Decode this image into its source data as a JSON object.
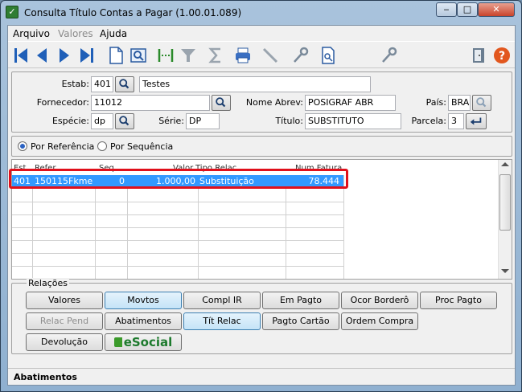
{
  "window": {
    "title": "Consulta Título Contas a Pagar (1.00.01.089)",
    "controls": {
      "minimize": "‒",
      "maximize": "□",
      "close": "✕"
    }
  },
  "menu": [
    "Arquivo",
    "Valores",
    "Ajuda"
  ],
  "toolbar_icons": [
    "first-record-icon",
    "previous-record-icon",
    "next-record-icon",
    "last-record-icon",
    "new-document-icon",
    "zoom-document-icon",
    "goto-icon",
    "filter-icon",
    "sum-icon",
    "print-icon",
    "pen-icon",
    "key-icon",
    "search-document-icon",
    "key-icon",
    "exit-door-icon",
    "help-icon"
  ],
  "header": {
    "estab_label": "Estab:",
    "estab_value": "401",
    "estab_name": "Testes",
    "fornecedor_label": "Fornecedor:",
    "fornecedor_value": "11012",
    "nome_abrev_label": "Nome Abrev:",
    "nome_abrev_value": "POSIGRAF ABR",
    "pais_label": "País:",
    "pais_value": "BRA",
    "especie_label": "Espécie:",
    "especie_value": "dp",
    "serie_label": "Série:",
    "serie_value": "DP",
    "titulo_label": "Título:",
    "titulo_value": "SUBSTITUTO",
    "parcela_label": "Parcela:",
    "parcela_value": "3"
  },
  "radios": {
    "por_referencia": "Por Referência",
    "por_sequencia": "Por Sequência",
    "selected": "por_referencia"
  },
  "grid": {
    "columns": [
      "Est",
      "Refer",
      "Seq",
      "Valor",
      "Tipo Relac",
      "Num Fatura"
    ],
    "rows": [
      {
        "est": "401",
        "refer": "150115Fkme",
        "seq": "0",
        "valor": "1.000,00",
        "tipo_relac": "Substituição",
        "num_fatura": "78.444"
      }
    ]
  },
  "relacoes": {
    "label": "Relações",
    "buttons": {
      "valores": "Valores",
      "movtos": "Movtos",
      "compl_ir": "Compl IR",
      "em_pagto": "Em Pagto",
      "ocor_bordero": "Ocor Borderô",
      "proc_pagto": "Proc Pagto",
      "relac_pend": "Relac Pend",
      "abatimentos": "Abatimentos",
      "tit_relac": "Tít Relac",
      "pagto_cartao": "Pagto Cartão",
      "ordem_compra": "Ordem Compra",
      "devolucao": "Devolução",
      "esocial": "eSocial"
    }
  },
  "status": {
    "text": "Abatimentos"
  },
  "colors": {
    "selection": "#3399ff",
    "highlight_border": "#e0101b",
    "toolbar_blue": "#1f5fb8"
  }
}
